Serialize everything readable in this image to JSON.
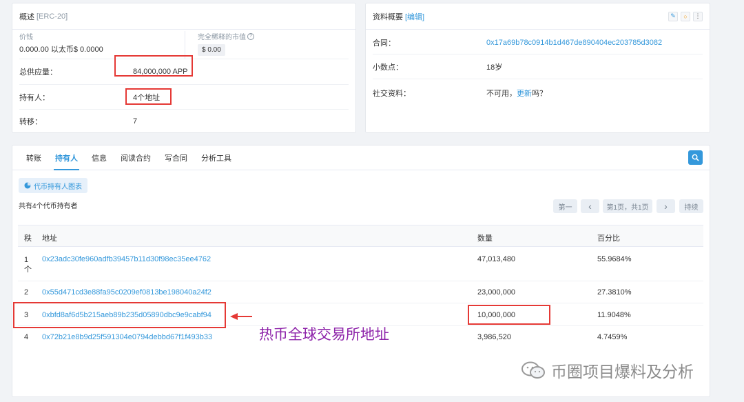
{
  "overview": {
    "title": "概述",
    "tag": "[ERC-20]",
    "price_label": "价钱",
    "price_value": "0.000.00 以太币$ 0.0000",
    "mcap_label": "完全稀释的市值",
    "mcap_value": "$ 0.00",
    "supply_label": "总供应量：",
    "supply_value": "84,000,000 APP",
    "holders_label": "持有人：",
    "holders_value": "4个地址",
    "transfers_label": "转移：",
    "transfers_value": "7"
  },
  "profile": {
    "title": "资料概要",
    "edit": "[编辑]",
    "contract_label": "合同：",
    "contract_value": "0x17a69b78c0914b1d467de890404ec203785d3082",
    "decimals_label": "小数点：",
    "decimals_value": "18岁",
    "social_label": "社交资料：",
    "social_prefix": "不可用，",
    "social_link": "更新",
    "social_suffix": "吗？"
  },
  "tabs": [
    {
      "label": "转账"
    },
    {
      "label": "持有人"
    },
    {
      "label": "信息"
    },
    {
      "label": "阅读合约"
    },
    {
      "label": "写合同"
    },
    {
      "label": "分析工具"
    }
  ],
  "holders": {
    "chart_button": "代币持有人图表",
    "summary": "共有4个代币持有者",
    "pager": {
      "first": "第一",
      "prev": "‹",
      "page": "第1页，共1页",
      "next": "›",
      "last": "持续"
    },
    "columns": {
      "rank": "秩",
      "address": "地址",
      "quantity": "数量",
      "percent": "百分比"
    },
    "rows": [
      {
        "rank": "1\n个",
        "address": "0x23adc30fe960adfb39457b11d30f98ec35ee4762",
        "quantity": "47,013,480",
        "percent": "55.9684%"
      },
      {
        "rank": "2",
        "address": "0x55d471cd3e88fa95c0209ef0813be198040a24f2",
        "quantity": "23,000,000",
        "percent": "27.3810%"
      },
      {
        "rank": "3",
        "address": "0xbfd8af6d5b215aeb89b235d05890dbc9e9cabf94",
        "quantity": "10,000,000",
        "percent": "11.9048%"
      },
      {
        "rank": "4",
        "address": "0x72b21e8b9d25f591304e0794debbd67f1f493b33",
        "quantity": "3,986,520",
        "percent": "4.7459%"
      }
    ]
  },
  "annotation": "热币全球交易所地址",
  "watermark": "币圈项目爆料及分析",
  "colors": {
    "accent": "#3498db",
    "highlight": "#e53935",
    "annotation": "#8e24aa"
  }
}
